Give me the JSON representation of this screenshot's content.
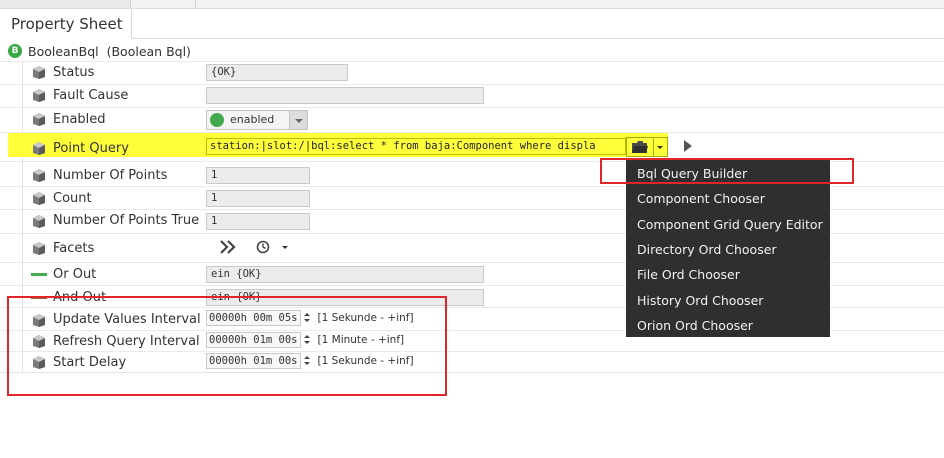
{
  "tab": {
    "label": "Property Sheet"
  },
  "header": {
    "icon_letter": "B",
    "name": "BooleanBql",
    "type": "(Boolean Bql)"
  },
  "properties": {
    "status": {
      "label": "Status",
      "value": "{OK}"
    },
    "fault_cause": {
      "label": "Fault Cause",
      "value": ""
    },
    "enabled": {
      "label": "Enabled",
      "value": "enabled"
    },
    "point_query": {
      "label": "Point Query",
      "value": "station:|slot:/|bql:select * from baja:Component where displa"
    },
    "number_of_points": {
      "label": "Number Of Points",
      "value": "1"
    },
    "count": {
      "label": "Count",
      "value": "1"
    },
    "number_of_points_true": {
      "label": "Number Of Points True",
      "value": "1"
    },
    "facets": {
      "label": "Facets"
    },
    "or_out": {
      "label": "Or Out",
      "value": "ein {OK}"
    },
    "and_out": {
      "label": "And Out",
      "value": "ein {OK}"
    },
    "update_values_interval": {
      "label": "Update Values Interval",
      "value": "00000h 00m 05s",
      "range": "[1 Sekunde - +inf]"
    },
    "refresh_query_interval": {
      "label": "Refresh Query Interval",
      "value": "00000h 01m 00s",
      "range": "[1 Minute - +inf]"
    },
    "start_delay": {
      "label": "Start Delay",
      "value": "00000h 01m 00s",
      "range": "[1 Sekunde - +inf]"
    }
  },
  "menu": {
    "items": [
      "Bql Query Builder",
      "Component Chooser",
      "Component Grid Query Editor",
      "Directory Ord Chooser",
      "File Ord Chooser",
      "History Ord Chooser",
      "Orion Ord Chooser"
    ]
  },
  "colors": {
    "highlight": "#ffff3a",
    "annotation_red": "#e0262b",
    "menu_bg": "#2f2f2f",
    "enabled_green": "#43a84f"
  },
  "icons": {
    "property": "cube-icon",
    "facets": "chevrons-right-icon",
    "time": "clock-icon",
    "folder": "folder-icon"
  }
}
